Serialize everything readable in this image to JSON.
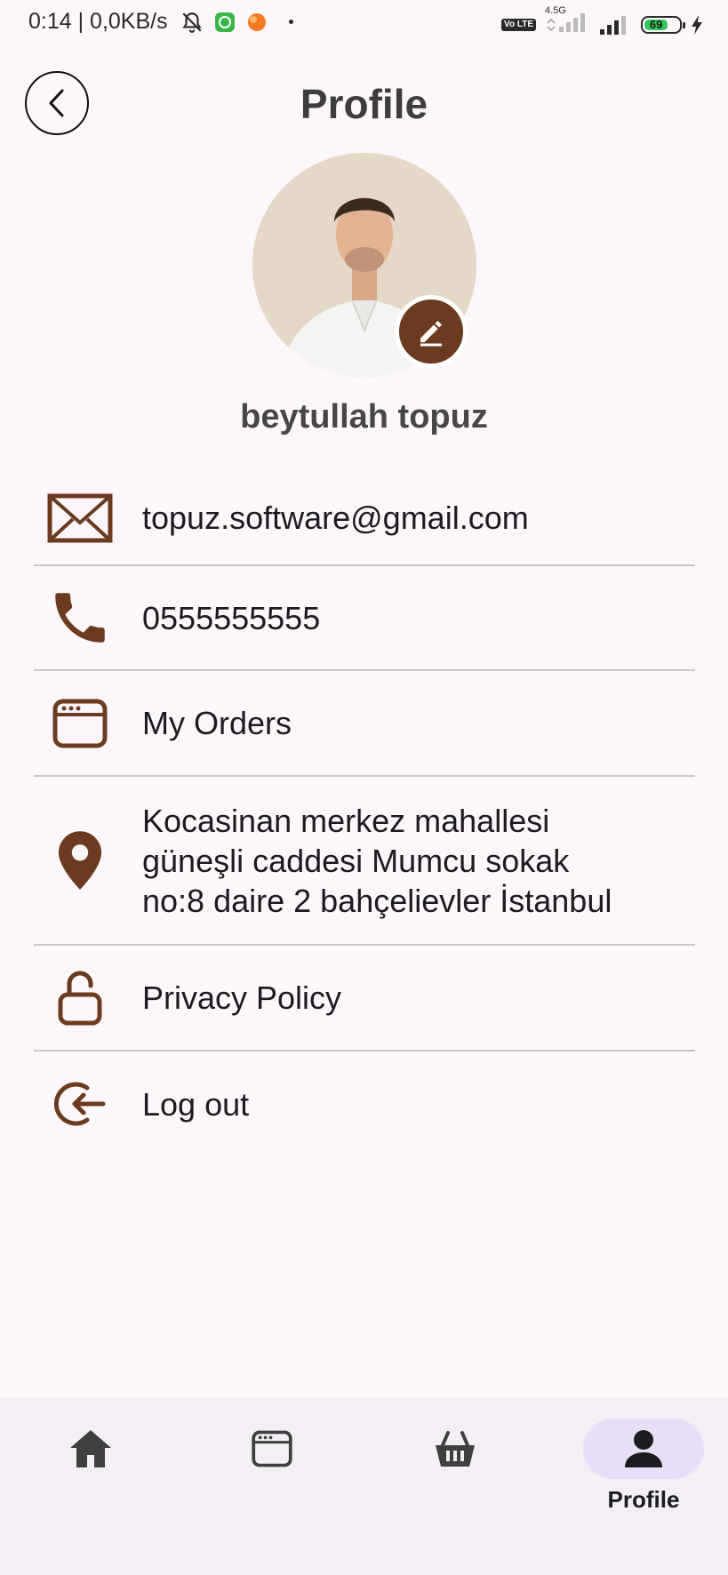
{
  "status_bar": {
    "time_speed": "0:14 | 0,0KB/s",
    "network": "4.5G",
    "volte": "Vo LTE",
    "battery": "69"
  },
  "header": {
    "title": "Profile"
  },
  "profile": {
    "name": "beytullah topuz"
  },
  "info": {
    "email": "topuz.software@gmail.com",
    "phone": "0555555555",
    "orders": "My Orders",
    "address_line1": "Kocasinan merkez mahallesi",
    "address_line2": "güneşli caddesi Mumcu sokak",
    "address_line3": "no:8 daire 2 bahçelievler İstanbul",
    "privacy": "Privacy Policy",
    "logout": "Log out"
  },
  "bottom_nav": {
    "items": [
      {
        "icon": "home-icon",
        "label": ""
      },
      {
        "icon": "orders-icon",
        "label": ""
      },
      {
        "icon": "basket-icon",
        "label": ""
      },
      {
        "icon": "person-icon",
        "label": "Profile",
        "active": true
      }
    ]
  },
  "colors": {
    "accent_brown": "#6b3b1f",
    "background": "#fdf7fb",
    "nav_background": "#f3eff4",
    "active_pill": "#e8def8"
  }
}
